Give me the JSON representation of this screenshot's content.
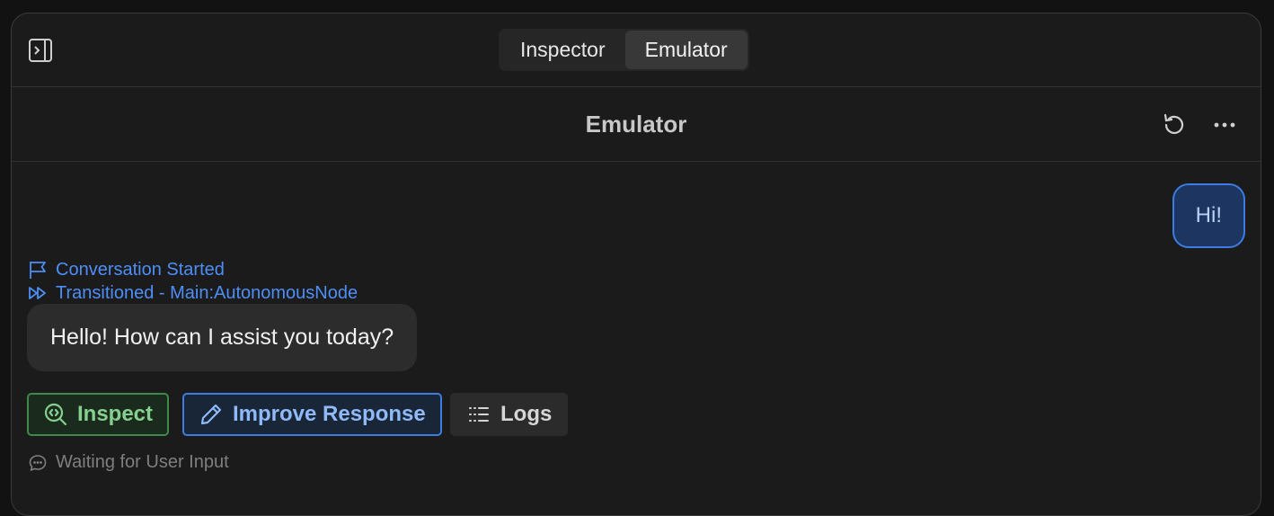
{
  "topbar": {
    "tabs": [
      {
        "label": "Inspector",
        "active": false
      },
      {
        "label": "Emulator",
        "active": true
      }
    ]
  },
  "header": {
    "title": "Emulator",
    "actions": [
      "refresh-icon",
      "more-icon"
    ]
  },
  "conversation": {
    "user_message": "Hi!",
    "events": [
      {
        "label": "Conversation Started",
        "icon": "flag-icon"
      },
      {
        "label": "Transitioned - Main:AutonomousNode",
        "icon": "fast-forward-icon"
      }
    ],
    "assistant_message": "Hello! How can I assist you today?",
    "actions": {
      "inspect": "Inspect",
      "improve": "Improve Response",
      "logs": "Logs"
    },
    "status": "Waiting for User Input"
  },
  "colors": {
    "accent_blue": "#4d8ef7",
    "inspect_green": "#86d08f",
    "user_bubble_bg": "#1c3561",
    "background": "#1b1b1b"
  }
}
